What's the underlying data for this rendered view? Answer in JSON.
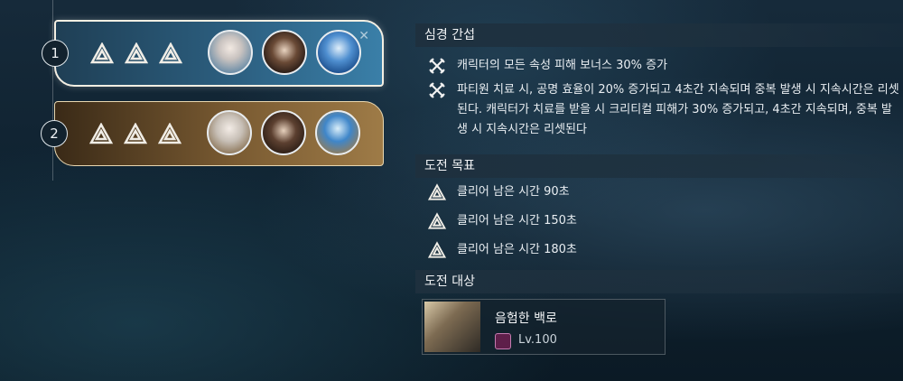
{
  "stages": [
    {
      "number": "1",
      "stars": 3,
      "theme": "blue",
      "selected": true,
      "portraits": [
        "portrait-1",
        "portrait-2",
        "portrait-3"
      ]
    },
    {
      "number": "2",
      "stars": 3,
      "theme": "gold",
      "selected": false,
      "portraits": [
        "portrait-1",
        "portrait-2",
        "portrait-3"
      ]
    }
  ],
  "interference": {
    "title": "심경 간섭",
    "items": [
      {
        "icon": "crossed-swords-icon",
        "text": "캐릭터의 모든 속성 피해 보너스 30% 증가"
      },
      {
        "icon": "crossed-swords-icon",
        "text": "파티원 치료 시, 공명 효율이 20% 증가되고 4초간 지속되며 중복 발생 시 지속시간은 리셋된다. 캐릭터가 치료를 받을 시 크리티컬 피해가 30% 증가되고, 4초간 지속되며, 중복 발생 시 지속시간은 리셋된다"
      }
    ]
  },
  "goals": {
    "title": "도전 목표",
    "items": [
      {
        "icon": "goal-triangle-icon",
        "text": "클리어 남은 시간 90초"
      },
      {
        "icon": "goal-triangle-icon",
        "text": "클리어 남은 시간 150초"
      },
      {
        "icon": "goal-triangle-icon",
        "text": "클리어 남은 시간 180초"
      }
    ]
  },
  "target": {
    "title": "도전 대상",
    "name": "음험한 백로",
    "level": "Lv.100",
    "icon": "boss-portrait"
  },
  "colors": {
    "accent_gold": "#e9d7b0",
    "selected_border": "#f4efe3"
  }
}
